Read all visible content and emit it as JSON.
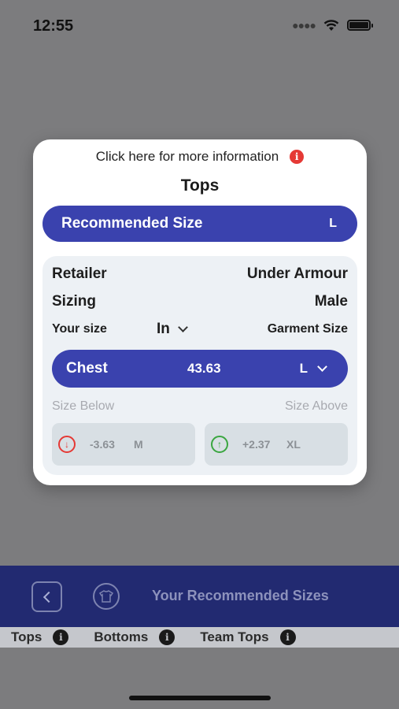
{
  "status_bar": {
    "time": "12:55"
  },
  "modal": {
    "info_text": "Click here for more information",
    "title": "Tops",
    "recommended": {
      "label": "Recommended Size",
      "value": "L"
    },
    "details": {
      "retailer_label": "Retailer",
      "retailer_value": "Under Armour",
      "sizing_label": "Sizing",
      "sizing_value": "Male",
      "your_size_label": "Your size",
      "unit": "In",
      "garment_size_label": "Garment Size"
    },
    "measurement": {
      "label": "Chest",
      "value": "43.63",
      "size": "L"
    },
    "size_below_label": "Size Below",
    "size_above_label": "Size Above",
    "below": {
      "delta": "-3.63",
      "size": "M"
    },
    "above": {
      "delta": "+2.37",
      "size": "XL"
    }
  },
  "bottom_bar": {
    "title": "Your Recommended Sizes"
  },
  "tabs": [
    {
      "label": "Tops"
    },
    {
      "label": "Bottoms"
    },
    {
      "label": "Team Tops"
    }
  ],
  "colors": {
    "accent": "#3a42ae",
    "nav": "#222a71",
    "down": "#e53935",
    "up": "#3aa640"
  },
  "icons": [
    "info-icon",
    "chevron-down-icon",
    "arrow-down-icon",
    "arrow-up-icon",
    "back-icon",
    "shirt-icon",
    "wifi-icon",
    "battery-icon"
  ]
}
